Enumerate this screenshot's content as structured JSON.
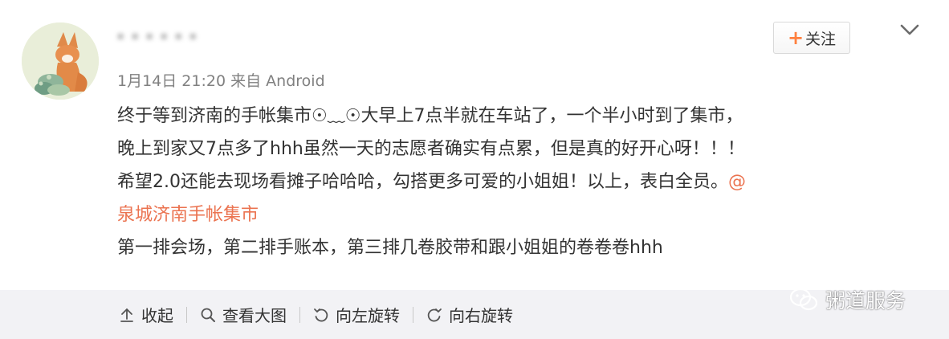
{
  "post": {
    "username": "·  ·  ·  ·  ·  ·",
    "follow_label": "关注",
    "follow_plus": "+",
    "meta": {
      "date": "1月14日 21:20",
      "from_label": "来自",
      "source": "Android"
    },
    "lines": [
      "终于等到济南的手帐集市☉﹏☉大早上7点半就在车站了，一个半小时到了集市，",
      "晚上到家又7点多了hhh虽然一天的志愿者确实有点累，但是真的好开心呀！！！",
      "希望2.0还能去现场看摊子哈哈哈，勾搭更多可爱的小姐姐！以上，表白全员。"
    ],
    "mention_prefix": "@",
    "mention": "泉城济南手帐集市",
    "last_line": "第一排会场，第二排手账本，第三排几卷胶带和跟小姐姐的卷卷卷hhh"
  },
  "toolbar": {
    "collapse_label": "收起",
    "view_large_label": "查看大图",
    "rotate_left_label": "向左旋转",
    "rotate_right_label": "向右旋转"
  },
  "watermark": {
    "text": "粥道服务"
  },
  "colors": {
    "mention": "#eb7350",
    "follow_plus": "#ff8140",
    "toolbar_bg": "#f2f2f5",
    "meta": "#808080"
  }
}
